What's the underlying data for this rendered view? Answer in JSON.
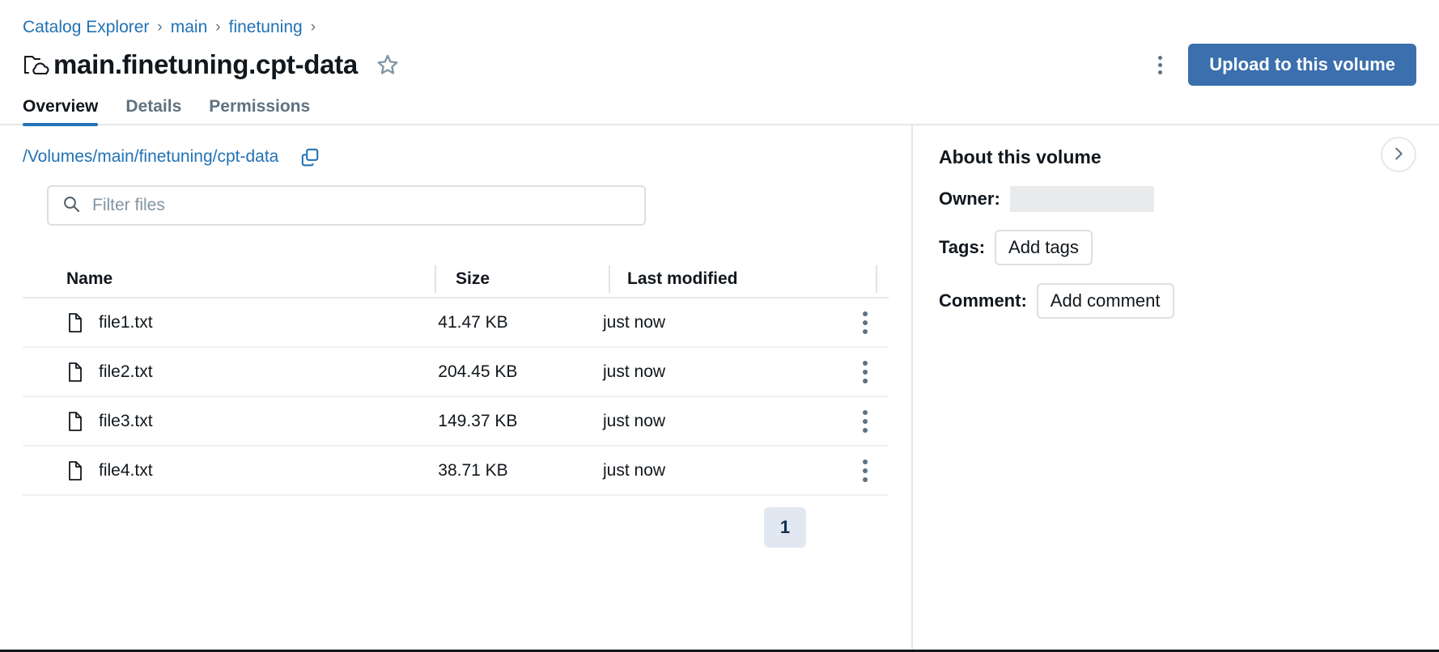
{
  "breadcrumb": {
    "items": [
      {
        "label": "Catalog Explorer"
      },
      {
        "label": "main"
      },
      {
        "label": "finetuning"
      }
    ],
    "separator": "›"
  },
  "header": {
    "title": "main.finetuning.cpt-data",
    "volume_icon": "folder-cloud-icon",
    "star_icon": "star-outline-icon",
    "kebab_icon": "more-vertical-icon",
    "upload_label": "Upload to this volume",
    "upload_color": "#3b6fad"
  },
  "tabs": [
    {
      "label": "Overview",
      "active": true
    },
    {
      "label": "Details",
      "active": false
    },
    {
      "label": "Permissions",
      "active": false
    }
  ],
  "main": {
    "path": "/Volumes/main/finetuning/cpt-data",
    "copy_icon": "copy-icon",
    "search": {
      "placeholder": "Filter files",
      "value": "",
      "icon": "search-icon"
    },
    "table": {
      "columns": [
        "Name",
        "Size",
        "Last modified"
      ],
      "rows": [
        {
          "name": "file1.txt",
          "size": "41.47 KB",
          "modified": "just now",
          "icon": "file-icon"
        },
        {
          "name": "file2.txt",
          "size": "204.45 KB",
          "modified": "just now",
          "icon": "file-icon"
        },
        {
          "name": "file3.txt",
          "size": "149.37 KB",
          "modified": "just now",
          "icon": "file-icon"
        },
        {
          "name": "file4.txt",
          "size": "38.71 KB",
          "modified": "just now",
          "icon": "file-icon"
        }
      ]
    },
    "pagination": {
      "current_page": "1"
    }
  },
  "sidebar": {
    "title": "About this volume",
    "owner_label": "Owner:",
    "owner_value": "",
    "tags_label": "Tags:",
    "add_tags_label": "Add tags",
    "comment_label": "Comment:",
    "add_comment_label": "Add comment",
    "collapse_icon": "chevron-right-icon"
  },
  "colors": {
    "link": "#2272b4",
    "accent": "#2272b4",
    "primary_button": "#3b6fad",
    "muted_text": "#5f7281",
    "border": "#e4e8ea"
  }
}
